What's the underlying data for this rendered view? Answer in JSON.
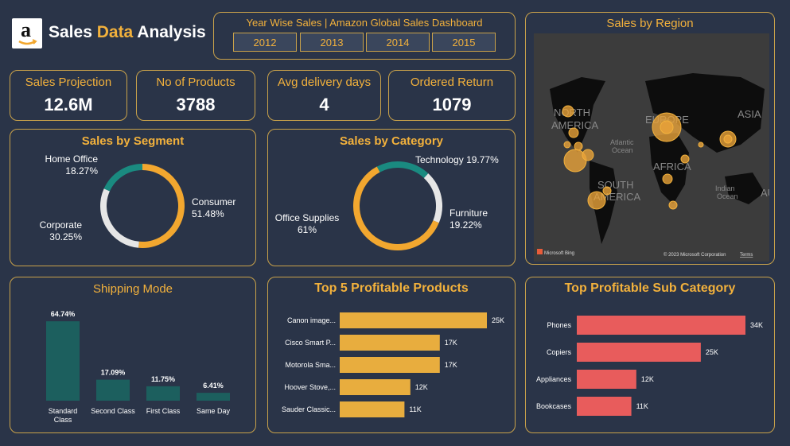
{
  "header": {
    "title_part1": "Sales ",
    "title_part2": "Data",
    "title_part3": " Analysis",
    "logo_letter": "a"
  },
  "years": {
    "title": "Year Wise Sales | Amazon Global Sales Dashboard",
    "items": [
      "2012",
      "2013",
      "2014",
      "2015"
    ]
  },
  "kpis": [
    {
      "label": "Sales Projection",
      "value": "12.6M"
    },
    {
      "label": "No of Products",
      "value": "3788"
    },
    {
      "label": "Avg delivery days",
      "value": "4"
    },
    {
      "label": "Ordered Return",
      "value": "1079"
    }
  ],
  "region": {
    "title": "Sales by Region",
    "labels": {
      "na1": "NORTH",
      "na2": "AMERICA",
      "eu": "EUROPE",
      "asia": "ASIA",
      "af": "AFRICA",
      "sa1": "SOUTH",
      "sa2": "AMERICA",
      "atl1": "Atlantic",
      "atl2": "Ocean",
      "ind1": "Indian",
      "ind2": "Ocean",
      "au": "AU"
    },
    "attribution": "© 2023 Microsoft Corporation",
    "terms": "Terms",
    "bing": "Microsoft Bing"
  },
  "segment": {
    "title": "Sales by Segment",
    "slices": [
      {
        "name": "Consumer",
        "pct": "51.48%",
        "value": 51.48,
        "color": "#f2a72f"
      },
      {
        "name": "Corporate",
        "pct": "30.25%",
        "value": 30.25,
        "color": "#e6e6e6"
      },
      {
        "name": "Home Office",
        "pct": "18.27%",
        "value": 18.27,
        "color": "#1a8a80"
      }
    ]
  },
  "category": {
    "title": "Sales by Category",
    "slices": [
      {
        "name": "Technology",
        "pct": "19.77%",
        "value": 19.77,
        "color": "#1a8a80"
      },
      {
        "name": "Furniture",
        "pct": "19.22%",
        "value": 19.22,
        "color": "#e6e6e6"
      },
      {
        "name": "Office Supplies",
        "pct": "61%",
        "value": 61.01,
        "color": "#f2a72f"
      }
    ]
  },
  "shipping": {
    "title": "Shipping Mode",
    "bars": [
      {
        "label": "Standard\nClass",
        "line1": "Standard",
        "line2": "Class",
        "value": 64.74,
        "text": "64.74%"
      },
      {
        "label": "Second Class",
        "line1": "Second Class",
        "line2": "",
        "value": 17.09,
        "text": "17.09%"
      },
      {
        "label": "First Class",
        "line1": "First Class",
        "line2": "",
        "value": 11.75,
        "text": "11.75%"
      },
      {
        "label": "Same Day",
        "line1": "Same Day",
        "line2": "",
        "value": 6.41,
        "text": "6.41%"
      }
    ],
    "color": "#1c5f5e"
  },
  "products": {
    "title": "Top 5 Profitable Products",
    "bars": [
      {
        "label": "Canon image...",
        "value": 25,
        "text": "25K"
      },
      {
        "label": "Cisco Smart P...",
        "value": 17,
        "text": "17K"
      },
      {
        "label": "Motorola Sma...",
        "value": 17,
        "text": "17K"
      },
      {
        "label": "Hoover Stove,...",
        "value": 12,
        "text": "12K"
      },
      {
        "label": "Sauder Classic...",
        "value": 11,
        "text": "11K"
      }
    ],
    "color": "#e8ad3e"
  },
  "subcat": {
    "title": "Top Profitable Sub Category",
    "bars": [
      {
        "label": "Phones",
        "value": 34,
        "text": "34K"
      },
      {
        "label": "Copiers",
        "value": 25,
        "text": "25K"
      },
      {
        "label": "Appliances",
        "value": 12,
        "text": "12K"
      },
      {
        "label": "Bookcases",
        "value": 11,
        "text": "11K"
      }
    ],
    "color": "#e85c5c"
  },
  "chart_data": [
    {
      "type": "pie",
      "title": "Sales by Segment",
      "categories": [
        "Consumer",
        "Corporate",
        "Home Office"
      ],
      "values": [
        51.48,
        30.25,
        18.27
      ]
    },
    {
      "type": "pie",
      "title": "Sales by Category",
      "categories": [
        "Technology",
        "Furniture",
        "Office Supplies"
      ],
      "values": [
        19.77,
        19.22,
        61
      ]
    },
    {
      "type": "bar",
      "title": "Shipping Mode",
      "categories": [
        "Standard Class",
        "Second Class",
        "First Class",
        "Same Day"
      ],
      "values": [
        64.74,
        17.09,
        11.75,
        6.41
      ]
    },
    {
      "type": "bar",
      "title": "Top 5 Profitable Products",
      "categories": [
        "Canon image...",
        "Cisco Smart P...",
        "Motorola Sma...",
        "Hoover Stove,...",
        "Sauder Classic..."
      ],
      "values": [
        25,
        17,
        17,
        12,
        11
      ]
    },
    {
      "type": "bar",
      "title": "Top Profitable Sub Category",
      "categories": [
        "Phones",
        "Copiers",
        "Appliances",
        "Bookcases"
      ],
      "values": [
        34,
        25,
        12,
        11
      ]
    }
  ]
}
